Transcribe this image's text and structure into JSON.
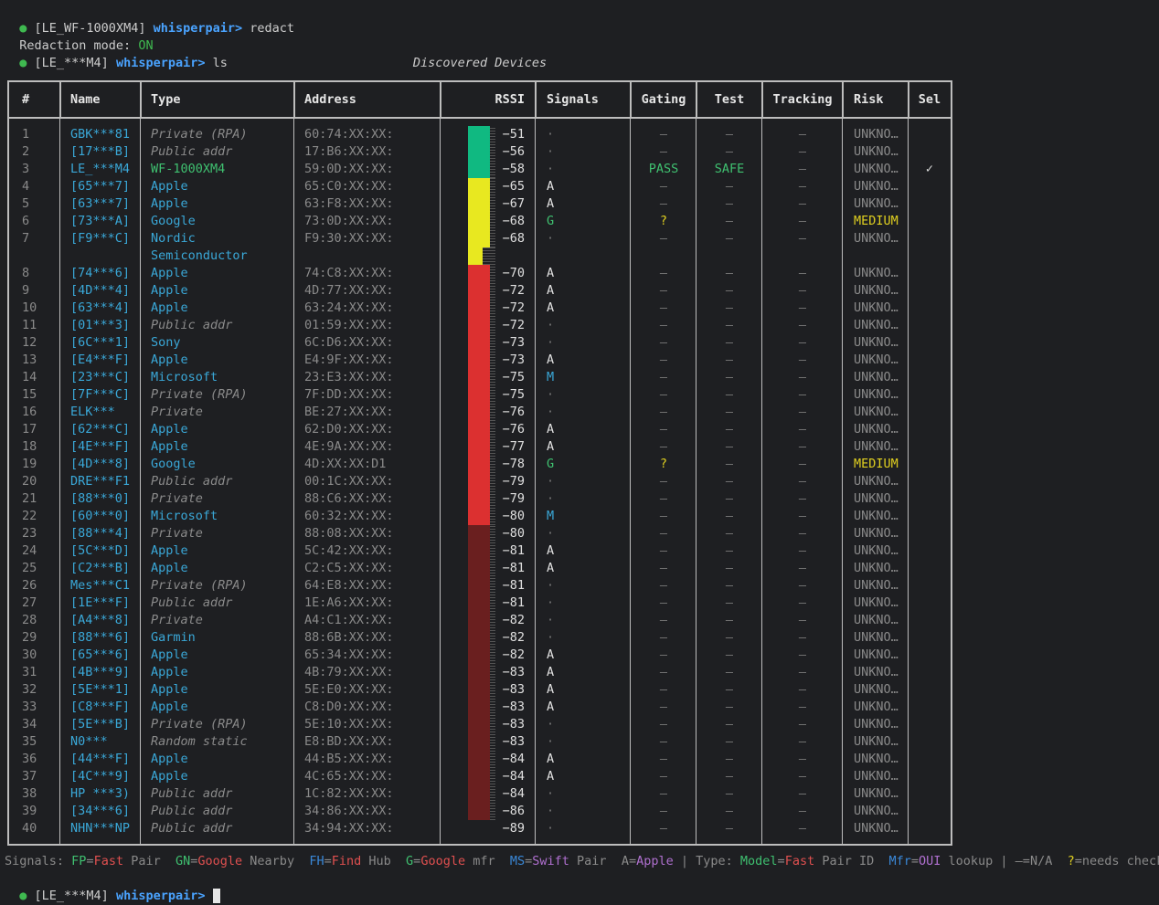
{
  "terminal": {
    "lines": [
      {
        "dot": "●",
        "prefix": " [LE_WF-1000XM4] ",
        "host": "whisperpair>",
        "cmd": " redact"
      },
      {
        "text": "Redaction mode: ",
        "status": "ON"
      },
      {
        "dot": "●",
        "prefix": " [LE_***M4] ",
        "host": "whisperpair>",
        "cmd": " ls"
      }
    ],
    "caption": "Discovered Devices"
  },
  "table": {
    "headers": [
      "#",
      "Name",
      "Type",
      "Address",
      "RSSI",
      "Signals",
      "Gating",
      "Test",
      "Tracking",
      "Risk",
      "Sel"
    ],
    "rows": [
      {
        "n": "1",
        "name": "GBK***81",
        "type": "Private (RPA)",
        "tk": "priv",
        "addr": "60:74:XX:XX:",
        "rssi": "−51",
        "sig": "·",
        "sk": "dim",
        "gate": "—",
        "gk": "dim",
        "test": "—",
        "tk2": "dim",
        "track": "—",
        "risk": "UNKNO…",
        "rk": "unk",
        "sel": ""
      },
      {
        "n": "2",
        "name": "[17***B]",
        "type": "Public addr",
        "tk": "priv",
        "addr": "17:B6:XX:XX:",
        "rssi": "−56",
        "sig": "·",
        "sk": "dim",
        "gate": "—",
        "gk": "dim",
        "test": "—",
        "tk2": "dim",
        "track": "—",
        "risk": "UNKNO…",
        "rk": "unk",
        "sel": ""
      },
      {
        "n": "3",
        "name": "LE_***M4",
        "type": "WF-1000XM4",
        "tk": "model",
        "addr": "59:0D:XX:XX:",
        "rssi": "−58",
        "sig": "·",
        "sk": "dim",
        "gate": "PASS",
        "gk": "pass",
        "test": "SAFE",
        "tk2": "pass",
        "track": "—",
        "risk": "UNKNO…",
        "rk": "unk",
        "sel": "✓"
      },
      {
        "n": "4",
        "name": "[65***7]",
        "type": "Apple",
        "tk": "brand",
        "addr": "65:C0:XX:XX:",
        "rssi": "−65",
        "sig": "A",
        "sk": "A",
        "gate": "—",
        "gk": "dim",
        "test": "—",
        "tk2": "dim",
        "track": "—",
        "risk": "UNKNO…",
        "rk": "unk",
        "sel": ""
      },
      {
        "n": "5",
        "name": "[63***7]",
        "type": "Apple",
        "tk": "brand",
        "addr": "63:F8:XX:XX:",
        "rssi": "−67",
        "sig": "A",
        "sk": "A",
        "gate": "—",
        "gk": "dim",
        "test": "—",
        "tk2": "dim",
        "track": "—",
        "risk": "UNKNO…",
        "rk": "unk",
        "sel": ""
      },
      {
        "n": "6",
        "name": "[73***A]",
        "type": "Google",
        "tk": "brand",
        "addr": "73:0D:XX:XX:",
        "rssi": "−68",
        "sig": "G",
        "sk": "G",
        "gate": "?",
        "gk": "q",
        "test": "—",
        "tk2": "dim",
        "track": "—",
        "risk": "MEDIUM",
        "rk": "med",
        "sel": ""
      },
      {
        "n": "7",
        "name": "[F9***C]",
        "type": "Nordic",
        "tk": "brand",
        "type2": "Semiconductor",
        "addr": "F9:30:XX:XX:",
        "rssi": "−68",
        "sig": "·",
        "sk": "dim",
        "gate": "—",
        "gk": "dim",
        "test": "—",
        "tk2": "dim",
        "track": "—",
        "risk": "UNKNO…",
        "rk": "unk",
        "sel": ""
      },
      {
        "n": "8",
        "name": "[74***6]",
        "type": "Apple",
        "tk": "brand",
        "addr": "74:C8:XX:XX:",
        "rssi": "−70",
        "sig": "A",
        "sk": "A",
        "gate": "—",
        "gk": "dim",
        "test": "—",
        "tk2": "dim",
        "track": "—",
        "risk": "UNKNO…",
        "rk": "unk",
        "sel": ""
      },
      {
        "n": "9",
        "name": "[4D***4]",
        "type": "Apple",
        "tk": "brand",
        "addr": "4D:77:XX:XX:",
        "rssi": "−72",
        "sig": "A",
        "sk": "A",
        "gate": "—",
        "gk": "dim",
        "test": "—",
        "tk2": "dim",
        "track": "—",
        "risk": "UNKNO…",
        "rk": "unk",
        "sel": ""
      },
      {
        "n": "10",
        "name": "[63***4]",
        "type": "Apple",
        "tk": "brand",
        "addr": "63:24:XX:XX:",
        "rssi": "−72",
        "sig": "A",
        "sk": "A",
        "gate": "—",
        "gk": "dim",
        "test": "—",
        "tk2": "dim",
        "track": "—",
        "risk": "UNKNO…",
        "rk": "unk",
        "sel": ""
      },
      {
        "n": "11",
        "name": "[01***3]",
        "type": "Public addr",
        "tk": "priv",
        "addr": "01:59:XX:XX:",
        "rssi": "−72",
        "sig": "·",
        "sk": "dim",
        "gate": "—",
        "gk": "dim",
        "test": "—",
        "tk2": "dim",
        "track": "—",
        "risk": "UNKNO…",
        "rk": "unk",
        "sel": ""
      },
      {
        "n": "12",
        "name": "[6C***1]",
        "type": "Sony",
        "tk": "brand",
        "addr": "6C:D6:XX:XX:",
        "rssi": "−73",
        "sig": "·",
        "sk": "dim",
        "gate": "—",
        "gk": "dim",
        "test": "—",
        "tk2": "dim",
        "track": "—",
        "risk": "UNKNO…",
        "rk": "unk",
        "sel": ""
      },
      {
        "n": "13",
        "name": "[E4***F]",
        "type": "Apple",
        "tk": "brand",
        "addr": "E4:9F:XX:XX:",
        "rssi": "−73",
        "sig": "A",
        "sk": "A",
        "gate": "—",
        "gk": "dim",
        "test": "—",
        "tk2": "dim",
        "track": "—",
        "risk": "UNKNO…",
        "rk": "unk",
        "sel": ""
      },
      {
        "n": "14",
        "name": "[23***C]",
        "type": "Microsoft",
        "tk": "brand",
        "addr": "23:E3:XX:XX:",
        "rssi": "−75",
        "sig": "M",
        "sk": "M",
        "gate": "—",
        "gk": "dim",
        "test": "—",
        "tk2": "dim",
        "track": "—",
        "risk": "UNKNO…",
        "rk": "unk",
        "sel": ""
      },
      {
        "n": "15",
        "name": "[7F***C]",
        "type": "Private (RPA)",
        "tk": "priv",
        "addr": "7F:DD:XX:XX:",
        "rssi": "−75",
        "sig": "·",
        "sk": "dim",
        "gate": "—",
        "gk": "dim",
        "test": "—",
        "tk2": "dim",
        "track": "—",
        "risk": "UNKNO…",
        "rk": "unk",
        "sel": ""
      },
      {
        "n": "16",
        "name": "ELK***",
        "type": "Private",
        "tk": "priv",
        "addr": "BE:27:XX:XX:",
        "rssi": "−76",
        "sig": "·",
        "sk": "dim",
        "gate": "—",
        "gk": "dim",
        "test": "—",
        "tk2": "dim",
        "track": "—",
        "risk": "UNKNO…",
        "rk": "unk",
        "sel": ""
      },
      {
        "n": "17",
        "name": "[62***C]",
        "type": "Apple",
        "tk": "brand",
        "addr": "62:D0:XX:XX:",
        "rssi": "−76",
        "sig": "A",
        "sk": "A",
        "gate": "—",
        "gk": "dim",
        "test": "—",
        "tk2": "dim",
        "track": "—",
        "risk": "UNKNO…",
        "rk": "unk",
        "sel": ""
      },
      {
        "n": "18",
        "name": "[4E***F]",
        "type": "Apple",
        "tk": "brand",
        "addr": "4E:9A:XX:XX:",
        "rssi": "−77",
        "sig": "A",
        "sk": "A",
        "gate": "—",
        "gk": "dim",
        "test": "—",
        "tk2": "dim",
        "track": "—",
        "risk": "UNKNO…",
        "rk": "unk",
        "sel": ""
      },
      {
        "n": "19",
        "name": "[4D***8]",
        "type": "Google",
        "tk": "brand",
        "addr": "4D:XX:XX:D1",
        "rssi": "−78",
        "sig": "G",
        "sk": "G",
        "gate": "?",
        "gk": "q",
        "test": "—",
        "tk2": "dim",
        "track": "—",
        "risk": "MEDIUM",
        "rk": "med",
        "sel": ""
      },
      {
        "n": "20",
        "name": "DRE***F1",
        "type": "Public addr",
        "tk": "priv",
        "addr": "00:1C:XX:XX:",
        "rssi": "−79",
        "sig": "·",
        "sk": "dim",
        "gate": "—",
        "gk": "dim",
        "test": "—",
        "tk2": "dim",
        "track": "—",
        "risk": "UNKNO…",
        "rk": "unk",
        "sel": ""
      },
      {
        "n": "21",
        "name": "[88***0]",
        "type": "Private",
        "tk": "priv",
        "addr": "88:C6:XX:XX:",
        "rssi": "−79",
        "sig": "·",
        "sk": "dim",
        "gate": "—",
        "gk": "dim",
        "test": "—",
        "tk2": "dim",
        "track": "—",
        "risk": "UNKNO…",
        "rk": "unk",
        "sel": ""
      },
      {
        "n": "22",
        "name": "[60***0]",
        "type": "Microsoft",
        "tk": "brand",
        "addr": "60:32:XX:XX:",
        "rssi": "−80",
        "sig": "M",
        "sk": "M",
        "gate": "—",
        "gk": "dim",
        "test": "—",
        "tk2": "dim",
        "track": "—",
        "risk": "UNKNO…",
        "rk": "unk",
        "sel": ""
      },
      {
        "n": "23",
        "name": "[88***4]",
        "type": "Private",
        "tk": "priv",
        "addr": "88:08:XX:XX:",
        "rssi": "−80",
        "sig": "·",
        "sk": "dim",
        "gate": "—",
        "gk": "dim",
        "test": "—",
        "tk2": "dim",
        "track": "—",
        "risk": "UNKNO…",
        "rk": "unk",
        "sel": ""
      },
      {
        "n": "24",
        "name": "[5C***D]",
        "type": "Apple",
        "tk": "brand",
        "addr": "5C:42:XX:XX:",
        "rssi": "−81",
        "sig": "A",
        "sk": "A",
        "gate": "—",
        "gk": "dim",
        "test": "—",
        "tk2": "dim",
        "track": "—",
        "risk": "UNKNO…",
        "rk": "unk",
        "sel": ""
      },
      {
        "n": "25",
        "name": "[C2***B]",
        "type": "Apple",
        "tk": "brand",
        "addr": "C2:C5:XX:XX:",
        "rssi": "−81",
        "sig": "A",
        "sk": "A",
        "gate": "—",
        "gk": "dim",
        "test": "—",
        "tk2": "dim",
        "track": "—",
        "risk": "UNKNO…",
        "rk": "unk",
        "sel": ""
      },
      {
        "n": "26",
        "name": "Mes***C1",
        "type": "Private (RPA)",
        "tk": "priv",
        "addr": "64:E8:XX:XX:",
        "rssi": "−81",
        "sig": "·",
        "sk": "dim",
        "gate": "—",
        "gk": "dim",
        "test": "—",
        "tk2": "dim",
        "track": "—",
        "risk": "UNKNO…",
        "rk": "unk",
        "sel": ""
      },
      {
        "n": "27",
        "name": "[1E***F]",
        "type": "Public addr",
        "tk": "priv",
        "addr": "1E:A6:XX:XX:",
        "rssi": "−81",
        "sig": "·",
        "sk": "dim",
        "gate": "—",
        "gk": "dim",
        "test": "—",
        "tk2": "dim",
        "track": "—",
        "risk": "UNKNO…",
        "rk": "unk",
        "sel": ""
      },
      {
        "n": "28",
        "name": "[A4***8]",
        "type": "Private",
        "tk": "priv",
        "addr": "A4:C1:XX:XX:",
        "rssi": "−82",
        "sig": "·",
        "sk": "dim",
        "gate": "—",
        "gk": "dim",
        "test": "—",
        "tk2": "dim",
        "track": "—",
        "risk": "UNKNO…",
        "rk": "unk",
        "sel": ""
      },
      {
        "n": "29",
        "name": "[88***6]",
        "type": "Garmin",
        "tk": "brand",
        "addr": "88:6B:XX:XX:",
        "rssi": "−82",
        "sig": "·",
        "sk": "dim",
        "gate": "—",
        "gk": "dim",
        "test": "—",
        "tk2": "dim",
        "track": "—",
        "risk": "UNKNO…",
        "rk": "unk",
        "sel": ""
      },
      {
        "n": "30",
        "name": "[65***6]",
        "type": "Apple",
        "tk": "brand",
        "addr": "65:34:XX:XX:",
        "rssi": "−82",
        "sig": "A",
        "sk": "A",
        "gate": "—",
        "gk": "dim",
        "test": "—",
        "tk2": "dim",
        "track": "—",
        "risk": "UNKNO…",
        "rk": "unk",
        "sel": ""
      },
      {
        "n": "31",
        "name": "[4B***9]",
        "type": "Apple",
        "tk": "brand",
        "addr": "4B:79:XX:XX:",
        "rssi": "−83",
        "sig": "A",
        "sk": "A",
        "gate": "—",
        "gk": "dim",
        "test": "—",
        "tk2": "dim",
        "track": "—",
        "risk": "UNKNO…",
        "rk": "unk",
        "sel": ""
      },
      {
        "n": "32",
        "name": "[5E***1]",
        "type": "Apple",
        "tk": "brand",
        "addr": "5E:E0:XX:XX:",
        "rssi": "−83",
        "sig": "A",
        "sk": "A",
        "gate": "—",
        "gk": "dim",
        "test": "—",
        "tk2": "dim",
        "track": "—",
        "risk": "UNKNO…",
        "rk": "unk",
        "sel": ""
      },
      {
        "n": "33",
        "name": "[C8***F]",
        "type": "Apple",
        "tk": "brand",
        "addr": "C8:D0:XX:XX:",
        "rssi": "−83",
        "sig": "A",
        "sk": "A",
        "gate": "—",
        "gk": "dim",
        "test": "—",
        "tk2": "dim",
        "track": "—",
        "risk": "UNKNO…",
        "rk": "unk",
        "sel": ""
      },
      {
        "n": "34",
        "name": "[5E***B]",
        "type": "Private (RPA)",
        "tk": "priv",
        "addr": "5E:10:XX:XX:",
        "rssi": "−83",
        "sig": "·",
        "sk": "dim",
        "gate": "—",
        "gk": "dim",
        "test": "—",
        "tk2": "dim",
        "track": "—",
        "risk": "UNKNO…",
        "rk": "unk",
        "sel": ""
      },
      {
        "n": "35",
        "name": "N0***",
        "type": "Random static",
        "tk": "priv",
        "addr": "E8:BD:XX:XX:",
        "rssi": "−83",
        "sig": "·",
        "sk": "dim",
        "gate": "—",
        "gk": "dim",
        "test": "—",
        "tk2": "dim",
        "track": "—",
        "risk": "UNKNO…",
        "rk": "unk",
        "sel": ""
      },
      {
        "n": "36",
        "name": "[44***F]",
        "type": "Apple",
        "tk": "brand",
        "addr": "44:B5:XX:XX:",
        "rssi": "−84",
        "sig": "A",
        "sk": "A",
        "gate": "—",
        "gk": "dim",
        "test": "—",
        "tk2": "dim",
        "track": "—",
        "risk": "UNKNO…",
        "rk": "unk",
        "sel": ""
      },
      {
        "n": "37",
        "name": "[4C***9]",
        "type": "Apple",
        "tk": "brand",
        "addr": "4C:65:XX:XX:",
        "rssi": "−84",
        "sig": "A",
        "sk": "A",
        "gate": "—",
        "gk": "dim",
        "test": "—",
        "tk2": "dim",
        "track": "—",
        "risk": "UNKNO…",
        "rk": "unk",
        "sel": ""
      },
      {
        "n": "38",
        "name": "HP ***3)",
        "type": "Public addr",
        "tk": "priv",
        "addr": "1C:82:XX:XX:",
        "rssi": "−84",
        "sig": "·",
        "sk": "dim",
        "gate": "—",
        "gk": "dim",
        "test": "—",
        "tk2": "dim",
        "track": "—",
        "risk": "UNKNO…",
        "rk": "unk",
        "sel": ""
      },
      {
        "n": "39",
        "name": "[34***6]",
        "type": "Public addr",
        "tk": "priv",
        "addr": "34:86:XX:XX:",
        "rssi": "−86",
        "sig": "·",
        "sk": "dim",
        "gate": "—",
        "gk": "dim",
        "test": "—",
        "tk2": "dim",
        "track": "—",
        "risk": "UNKNO…",
        "rk": "unk",
        "sel": ""
      },
      {
        "n": "40",
        "name": "NHN***NP",
        "type": "Public addr",
        "tk": "priv",
        "addr": "34:94:XX:XX:",
        "rssi": "−89",
        "sig": "·",
        "sk": "dim",
        "gate": "—",
        "gk": "dim",
        "test": "—",
        "tk2": "dim",
        "track": "—",
        "risk": "UNKNO…",
        "rk": "unk",
        "sel": ""
      }
    ],
    "rssi_bar": [
      {
        "color": "#10b981",
        "rows": 3
      },
      {
        "color": "#e8e820",
        "rows": 4
      },
      {
        "color": "#e8e820",
        "rows": 1,
        "partial": true
      },
      {
        "color": "#dc3030",
        "rows": 15
      },
      {
        "color": "#6a1f1f",
        "rows": 17
      }
    ]
  },
  "legend": [
    {
      "t": "Signals: ",
      "c": "lbl"
    },
    {
      "t": "FP",
      "c": "grn"
    },
    {
      "t": "=",
      "c": "lbl"
    },
    {
      "t": "Fast",
      "c": "red"
    },
    {
      "t": " Pair  ",
      "c": "lbl"
    },
    {
      "t": "GN",
      "c": "grn"
    },
    {
      "t": "=",
      "c": "lbl"
    },
    {
      "t": "Google",
      "c": "red"
    },
    {
      "t": " Nearby  ",
      "c": "lbl"
    },
    {
      "t": "FH",
      "c": "blu"
    },
    {
      "t": "=",
      "c": "lbl"
    },
    {
      "t": "Find",
      "c": "red"
    },
    {
      "t": " Hub  ",
      "c": "lbl"
    },
    {
      "t": "G",
      "c": "grn"
    },
    {
      "t": "=",
      "c": "lbl"
    },
    {
      "t": "Google",
      "c": "red"
    },
    {
      "t": " mfr  ",
      "c": "lbl"
    },
    {
      "t": "MS",
      "c": "blu"
    },
    {
      "t": "=",
      "c": "lbl"
    },
    {
      "t": "Swift",
      "c": "pur"
    },
    {
      "t": " Pair  ",
      "c": "lbl"
    },
    {
      "t": "A",
      "c": "lbl"
    },
    {
      "t": "=",
      "c": "lbl"
    },
    {
      "t": "Apple",
      "c": "pur"
    },
    {
      "t": " | Type: ",
      "c": "lbl"
    },
    {
      "t": "Model",
      "c": "grn"
    },
    {
      "t": "=",
      "c": "lbl"
    },
    {
      "t": "Fast",
      "c": "red"
    },
    {
      "t": " Pair ID  ",
      "c": "lbl"
    },
    {
      "t": "Mfr",
      "c": "blu"
    },
    {
      "t": "=",
      "c": "lbl"
    },
    {
      "t": "OUI",
      "c": "pur"
    },
    {
      "t": " lookup | —=N/A  ",
      "c": "lbl"
    },
    {
      "t": "?",
      "c": "yel"
    },
    {
      "t": "=needs check",
      "c": "lbl"
    }
  ],
  "prompt": {
    "dot": "●",
    "prefix": " [LE_***M4] ",
    "host": "whisperpair>",
    "cmd": " "
  }
}
